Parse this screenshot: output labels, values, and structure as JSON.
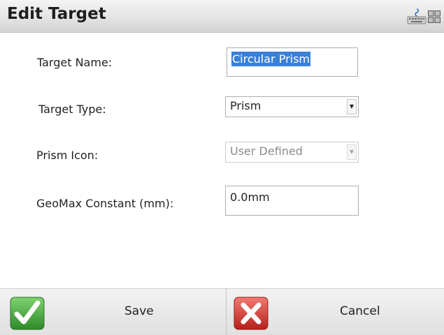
{
  "header": {
    "title": "Edit Target",
    "icons": [
      "keyboard-icon",
      "grid-icon"
    ]
  },
  "form": {
    "target_name": {
      "label": "Target Name:",
      "value": "Circular Prism"
    },
    "target_type": {
      "label": "Target Type:",
      "value": "Prism"
    },
    "prism_icon": {
      "label": "Prism Icon:",
      "value": "User Defined"
    },
    "constant": {
      "label": "GeoMax Constant (mm):",
      "value": "0.0mm"
    }
  },
  "footer": {
    "save_label": "Save",
    "cancel_label": "Cancel",
    "save_icon": "checkmark-icon",
    "cancel_icon": "x-icon"
  },
  "colors": {
    "selection": "#3a7fd8",
    "save_green": "#3aa033",
    "cancel_red": "#d8322b"
  }
}
